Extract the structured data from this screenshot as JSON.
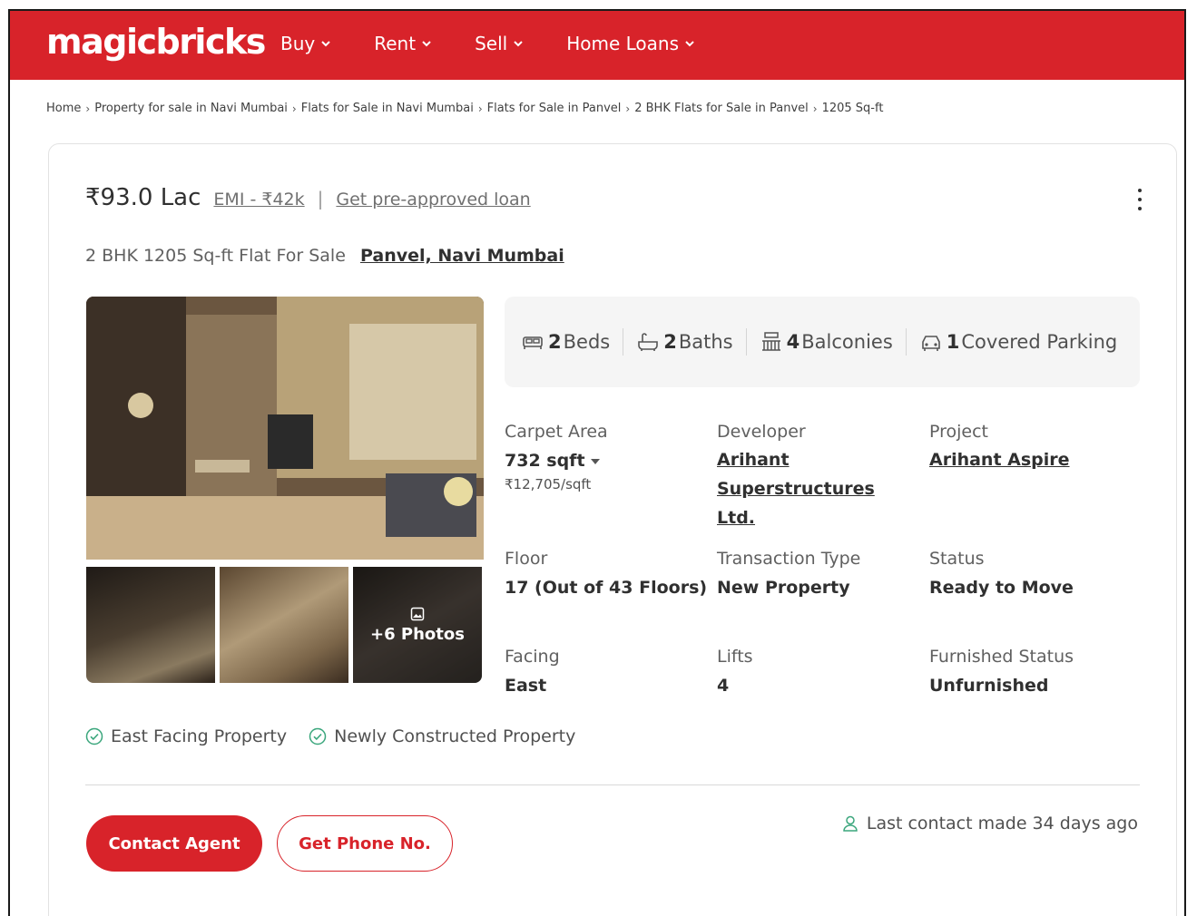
{
  "header": {
    "logo": "magicbricks",
    "nav": [
      {
        "label": "Buy"
      },
      {
        "label": "Rent"
      },
      {
        "label": "Sell"
      },
      {
        "label": "Home Loans"
      }
    ]
  },
  "breadcrumb": [
    "Home",
    "Property for sale in Navi Mumbai",
    "Flats for Sale in Navi Mumbai",
    "Flats for Sale in Panvel",
    "2 BHK Flats for Sale in Panvel",
    "1205 Sq-ft"
  ],
  "listing": {
    "price": "₹93.0 Lac",
    "emi": "EMI - ₹42k",
    "pipe": "|",
    "loan_link": "Get pre-approved loan",
    "title": "2 BHK 1205 Sq-ft Flat For Sale",
    "location": "Panvel, Navi Mumbai",
    "more_photos": "+6 Photos",
    "features": {
      "beds_count": "2",
      "beds_label": "Beds",
      "baths_count": "2",
      "baths_label": "Baths",
      "balconies_count": "4",
      "balconies_label": "Balconies",
      "parking_count": "1",
      "parking_label": "Covered Parking"
    },
    "specs": {
      "carpet_area_label": "Carpet Area",
      "carpet_area_value": "732 sqft",
      "carpet_area_rate": "₹12,705/sqft",
      "developer_label": "Developer",
      "developer_value": "Arihant Superstructures Ltd.",
      "project_label": "Project",
      "project_value": "Arihant Aspire",
      "floor_label": "Floor",
      "floor_value": "17 (Out of 43 Floors)",
      "transaction_label": "Transaction Type",
      "transaction_value": "New Property",
      "status_label": "Status",
      "status_value": "Ready to Move",
      "facing_label": "Facing",
      "facing_value": "East",
      "lifts_label": "Lifts",
      "lifts_value": "4",
      "furnished_label": "Furnished Status",
      "furnished_value": "Unfurnished"
    },
    "tags": [
      "East Facing Property",
      "Newly Constructed Property"
    ],
    "contact_button": "Contact Agent",
    "phone_button": "Get Phone No.",
    "last_contact": "Last contact made 34 days ago"
  },
  "colors": {
    "brand_red": "#d8232a",
    "check_green": "#3aa67c",
    "text_dark": "#303030"
  }
}
